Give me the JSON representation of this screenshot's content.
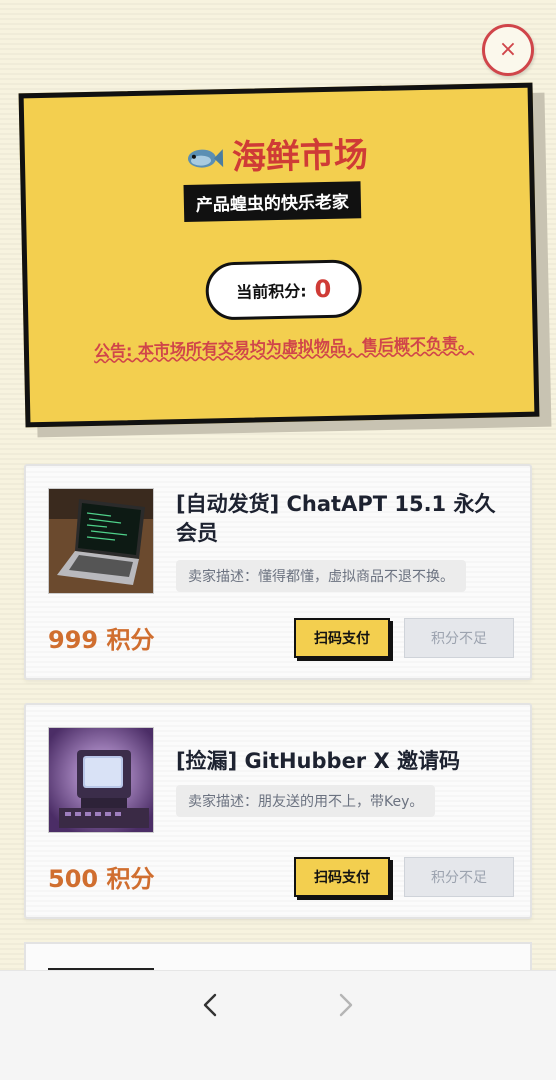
{
  "close": {
    "symbol": "×"
  },
  "hero": {
    "title": "海鲜市场",
    "subtitle": "产品蝗虫的快乐老家",
    "points_label": "当前积分:",
    "points_value": "0",
    "notice": "公告: 本市场所有交易均为虚拟物品，售后概不负责。"
  },
  "products": [
    {
      "title": "[自动发货] ChatAPT 15.1 永久会员",
      "description": "卖家描述：懂得都懂，虚拟商品不退不换。",
      "price": "999 积分",
      "pay_label": "扫码支付",
      "insufficient_label": "积分不足",
      "thumb_icon": "laptop-code-image"
    },
    {
      "title": "[捡漏] GitHubber X 邀请码",
      "description": "卖家描述：朋友送的用不上，带Key。",
      "price": "500 积分",
      "pay_label": "扫码支付",
      "insufficient_label": "积分不足",
      "thumb_icon": "retro-computer-image"
    }
  ],
  "browser": {
    "back_icon": "chevron-left-icon",
    "forward_icon": "chevron-right-icon"
  },
  "colors": {
    "accent_red": "#cf3b36",
    "hero_yellow": "#f3cf4f",
    "price_orange": "#d06e2f"
  }
}
